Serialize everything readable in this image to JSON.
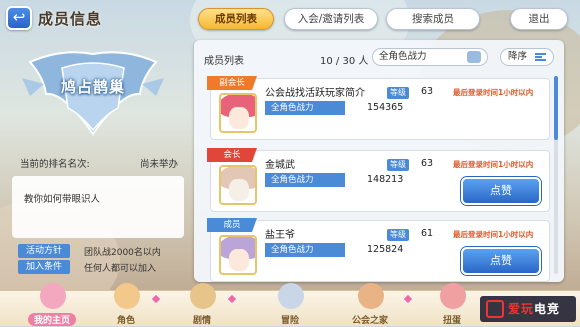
{
  "header": {
    "title": "成员信息",
    "back_icon": "back-arrow-icon",
    "tabs": [
      {
        "label": "成员列表",
        "active": true
      },
      {
        "label": "入会/邀请列表",
        "active": false
      },
      {
        "label": "搜索成员",
        "active": false
      },
      {
        "label": "退出",
        "active": false
      }
    ]
  },
  "guild": {
    "name": "鸠占鹊巢",
    "rank_label": "当前的排名名次:",
    "rank_value": "尚未举办",
    "description": "教你如何带眼识人",
    "activity_label": "活动方针",
    "activity_value": "团队战2000名以内",
    "join_label": "加入条件",
    "join_value": "任何人都可以加入"
  },
  "list": {
    "title": "成员列表",
    "count": "10 / 30 人",
    "filter_value": "全角色战力",
    "sort_label": "降序",
    "members": [
      {
        "role": "副会长",
        "role_color": "#f07a2a",
        "name": "公会战找活跃玩家简介",
        "level_label": "等级",
        "level": "63",
        "last_login": "最后登录时间1小时以内",
        "power_label": "全角色战力",
        "power": "154365",
        "like_label": "",
        "hair": "#e8627a"
      },
      {
        "role": "会长",
        "role_color": "#e0463a",
        "name": "金城武",
        "level_label": "等级",
        "level": "63",
        "last_login": "最后登录时间1小时以内",
        "power_label": "全角色战力",
        "power": "148213",
        "like_label": "点赞",
        "hair": "#e3c7b6"
      },
      {
        "role": "成员",
        "role_color": "#4a8ad6",
        "name": "盐王爷",
        "level_label": "等级",
        "level": "61",
        "last_login": "最后登录时间1小时以内",
        "power_label": "全角色战力",
        "power": "125824",
        "like_label": "点赞",
        "hair": "#b9a5d8"
      }
    ]
  },
  "nav": {
    "items": [
      {
        "label": "我的主页",
        "icon": "home-icon",
        "color": "#f3a8c0",
        "active": true
      },
      {
        "label": "角色",
        "icon": "character-icon",
        "color": "#f2c98a",
        "active": false
      },
      {
        "label": "剧情",
        "icon": "story-book-icon",
        "color": "#e6c48a",
        "active": false
      },
      {
        "label": "冒险",
        "icon": "sword-icon",
        "color": "#c9d6e8",
        "active": false
      },
      {
        "label": "公会之家",
        "icon": "guild-house-icon",
        "color": "#e8b486",
        "active": false
      },
      {
        "label": "扭蛋",
        "icon": "gacha-icon",
        "color": "#f0a0a0",
        "active": false
      }
    ]
  },
  "watermark": {
    "text_a": "爱玩",
    "text_b": "电竞"
  }
}
